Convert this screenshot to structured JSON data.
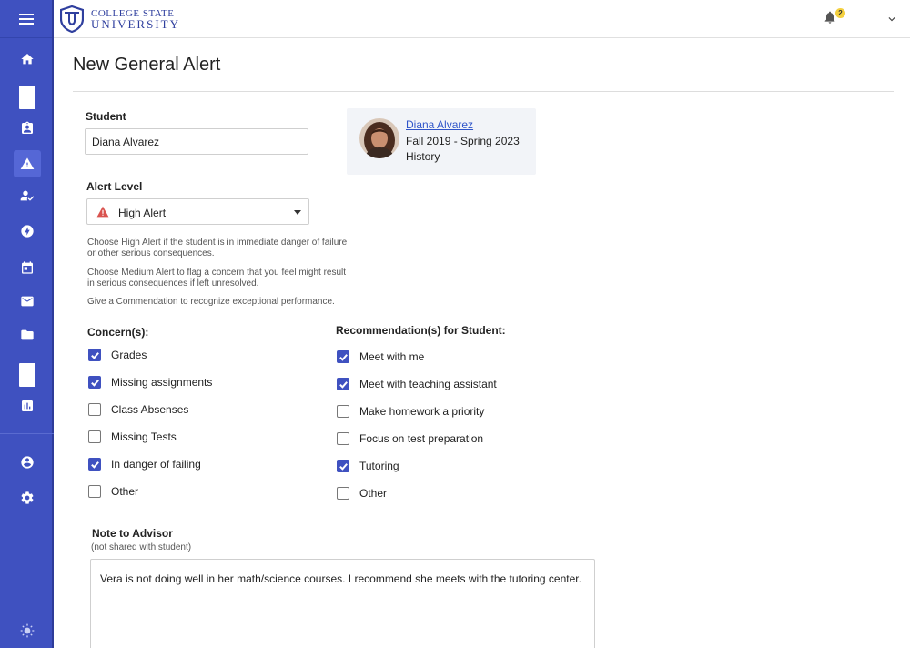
{
  "brand": {
    "line1": "COLLEGE STATE",
    "line2": "UNIVERSITY",
    "color": "#3f51c0"
  },
  "notifications": {
    "count": "2"
  },
  "page": {
    "title": "New General Alert"
  },
  "student": {
    "label": "Student",
    "value": "Diana Alvarez",
    "card": {
      "name": "Diana Alvarez",
      "term": "Fall 2019 - Spring 2023",
      "major": "History"
    }
  },
  "alert_level": {
    "label": "Alert Level",
    "selected": "High Alert",
    "help": [
      "Choose High Alert if the student is in immediate danger of failure or other serious consequences.",
      "Choose Medium Alert to flag a concern that you feel might result in serious consequences if left unresolved.",
      "Give a Commendation to recognize exceptional performance."
    ]
  },
  "concerns": {
    "heading": "Concern(s):",
    "items": [
      {
        "label": "Grades",
        "checked": true
      },
      {
        "label": "Missing assignments",
        "checked": true
      },
      {
        "label": "Class Absenses",
        "checked": false
      },
      {
        "label": "Missing Tests",
        "checked": false
      },
      {
        "label": "In danger of failing",
        "checked": true
      },
      {
        "label": "Other",
        "checked": false
      }
    ]
  },
  "recommendations": {
    "heading": "Recommendation(s) for Student:",
    "items": [
      {
        "label": "Meet with me",
        "checked": true
      },
      {
        "label": "Meet with teaching assistant",
        "checked": true
      },
      {
        "label": "Make homework a priority",
        "checked": false
      },
      {
        "label": "Focus on test preparation",
        "checked": false
      },
      {
        "label": "Tutoring",
        "checked": true
      },
      {
        "label": "Other",
        "checked": false
      }
    ]
  },
  "note": {
    "label": "Note to Advisor",
    "sublabel": "(not shared with student)",
    "value": "Vera is not doing well in her math/science courses. I recommend she meets with the tutoring center."
  }
}
